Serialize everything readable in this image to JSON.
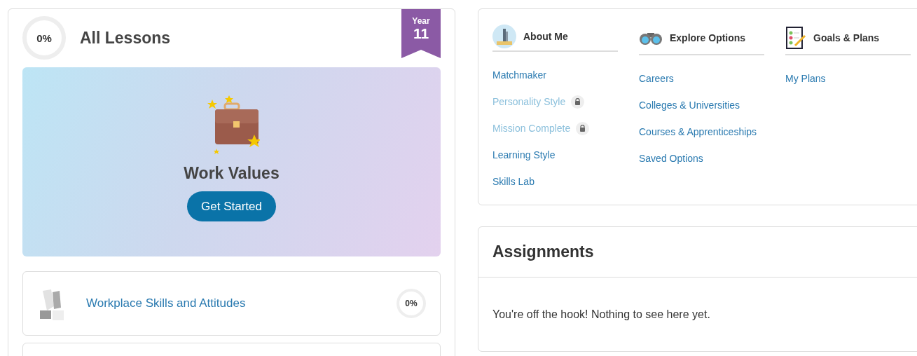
{
  "lessons_panel": {
    "progress": "0%",
    "title": "All Lessons",
    "badge": {
      "label": "Year",
      "number": "11"
    },
    "featured": {
      "title": "Work Values",
      "button": "Get Started"
    },
    "lessons": [
      {
        "title": "Workplace Skills and Attitudes",
        "progress": "0%"
      }
    ]
  },
  "nav": {
    "columns": [
      {
        "title": "About Me",
        "links": [
          {
            "label": "Matchmaker",
            "locked": false
          },
          {
            "label": "Personality Style",
            "locked": true
          },
          {
            "label": "Mission Complete",
            "locked": true
          },
          {
            "label": "Learning Style",
            "locked": false
          },
          {
            "label": "Skills Lab",
            "locked": false
          }
        ]
      },
      {
        "title": "Explore Options",
        "links": [
          {
            "label": "Careers",
            "locked": false
          },
          {
            "label": "Colleges & Universities",
            "locked": false
          },
          {
            "label": "Courses & Apprenticeships",
            "locked": false
          },
          {
            "label": "Saved Options",
            "locked": false
          }
        ]
      },
      {
        "title": "Goals & Plans",
        "links": [
          {
            "label": "My Plans",
            "locked": false
          }
        ]
      }
    ]
  },
  "assignments": {
    "title": "Assignments",
    "message": "You're off the hook! Nothing to see here yet."
  }
}
